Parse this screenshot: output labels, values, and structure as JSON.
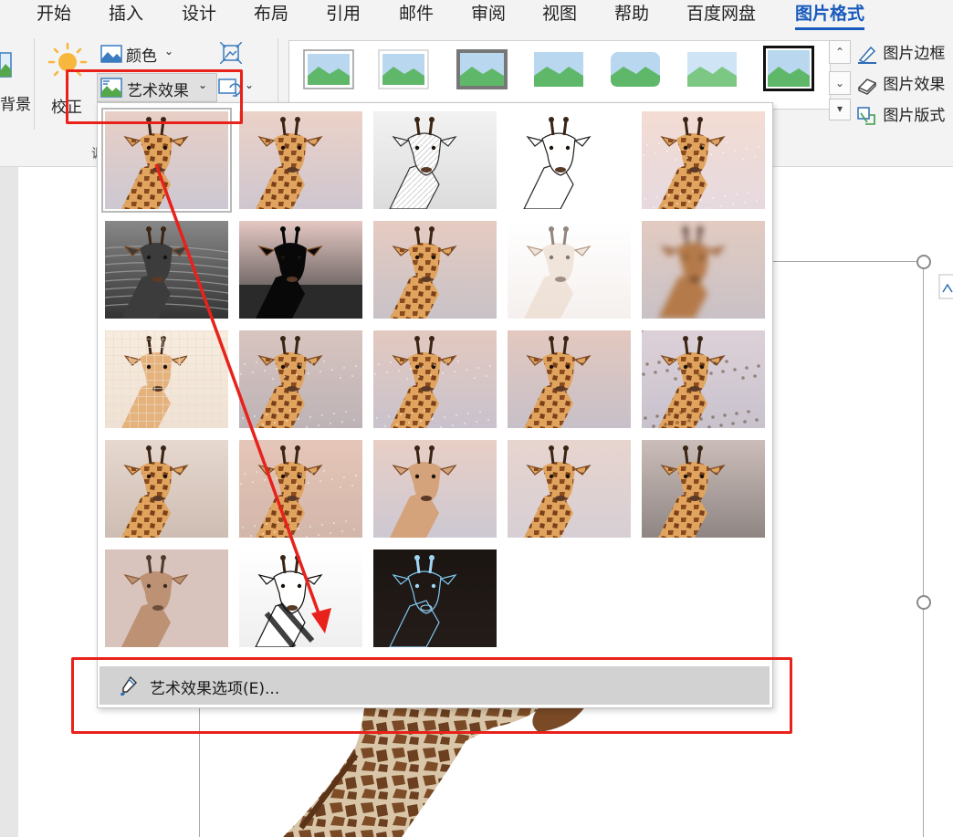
{
  "tabs": [
    {
      "label": "开始"
    },
    {
      "label": "插入"
    },
    {
      "label": "设计"
    },
    {
      "label": "布局"
    },
    {
      "label": "引用"
    },
    {
      "label": "邮件"
    },
    {
      "label": "审阅"
    },
    {
      "label": "视图"
    },
    {
      "label": "帮助"
    },
    {
      "label": "百度网盘"
    },
    {
      "label": "图片格式",
      "active": true
    }
  ],
  "ribbon": {
    "remove_background_label": "背景",
    "corrections_label": "校正",
    "color_label": "颜色",
    "artistic_effects_label": "艺术效果",
    "picture_border_label": "图片边框",
    "picture_effects_label": "图片效果",
    "picture_layout_label": "图片版式",
    "group_label_fragment": "调"
  },
  "dropdown": {
    "options_label": "艺术效果选项(E)...",
    "effects": [
      {
        "name": "none",
        "selected": true
      },
      {
        "name": "marker"
      },
      {
        "name": "pencil-grayscale"
      },
      {
        "name": "pencil-sketch"
      },
      {
        "name": "line-drawing"
      },
      {
        "name": "chalk-sketch"
      },
      {
        "name": "paint-strokes"
      },
      {
        "name": "paint-brush"
      },
      {
        "name": "glow-diffused"
      },
      {
        "name": "blur"
      },
      {
        "name": "light-screen"
      },
      {
        "name": "watercolor-sponge"
      },
      {
        "name": "film-grain"
      },
      {
        "name": "mosaic-bubbles"
      },
      {
        "name": "glass"
      },
      {
        "name": "cement"
      },
      {
        "name": "texturizer"
      },
      {
        "name": "crisscross-etching"
      },
      {
        "name": "pastels-smooth"
      },
      {
        "name": "plastic-wrap"
      },
      {
        "name": "cutout"
      },
      {
        "name": "photocopy"
      },
      {
        "name": "glow-edges"
      }
    ]
  },
  "colors": {
    "accent": "#185abd",
    "annotation_red": "#e8211b"
  }
}
